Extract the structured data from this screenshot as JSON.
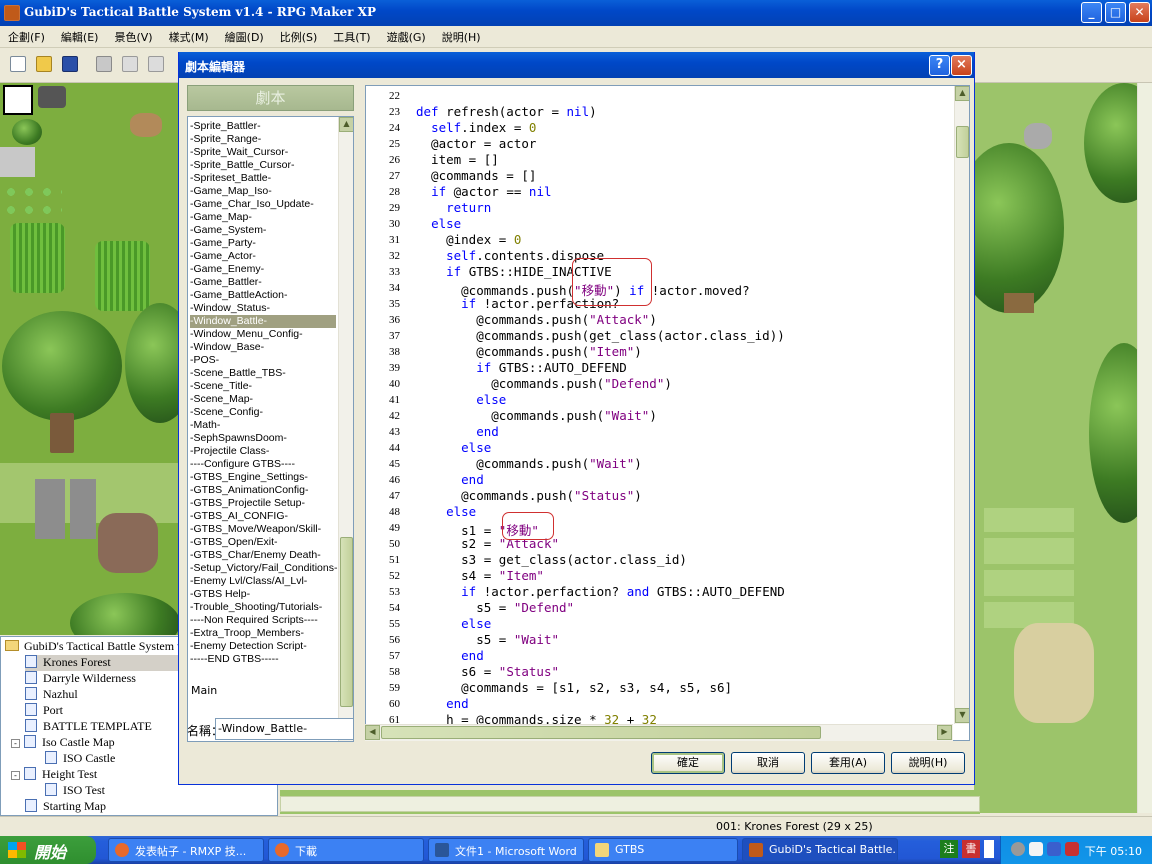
{
  "app": {
    "title": "GubiD's Tactical Battle System v1.4 - RPG Maker XP"
  },
  "menu": [
    "企劃(F)",
    "編輯(E)",
    "景色(V)",
    "樣式(M)",
    "繪圖(D)",
    "比例(S)",
    "工具(T)",
    "遊戲(G)",
    "說明(H)"
  ],
  "map_tree": {
    "root": "GubiD's Tactical Battle System v",
    "items": [
      {
        "label": "Krones Forest",
        "selected": true
      },
      {
        "label": "Darryle Wilderness"
      },
      {
        "label": "Nazhul"
      },
      {
        "label": "Port"
      },
      {
        "label": "BATTLE TEMPLATE"
      },
      {
        "label": "Iso Castle Map",
        "expander": "-"
      },
      {
        "label": "ISO Castle",
        "child": true
      },
      {
        "label": "Height Test",
        "expander": "-"
      },
      {
        "label": "ISO Test",
        "child": true
      },
      {
        "label": "Starting Map"
      }
    ]
  },
  "dialog": {
    "title": "劇本編輯器",
    "help_btn": "?",
    "close_btn": "×",
    "scripts_header": "劇本",
    "name_label": "名稱：",
    "name_value": "-Window_Battle-",
    "buttons": {
      "ok": "確定",
      "cancel": "取消",
      "apply": "套用(A)",
      "help": "說明(H)"
    }
  },
  "scripts": [
    "-Sprite_Battler-",
    "-Sprite_Range-",
    "-Sprite_Wait_Cursor-",
    "-Sprite_Battle_Cursor-",
    "-Spriteset_Battle-",
    "-Game_Map_Iso-",
    "-Game_Char_Iso_Update-",
    "-Game_Map-",
    "-Game_System-",
    "-Game_Party-",
    "-Game_Actor-",
    "-Game_Enemy-",
    "-Game_Battler-",
    "-Game_BattleAction-",
    "-Window_Status-",
    "-Window_Battle-",
    "-Window_Menu_Config-",
    "-Window_Base-",
    "-POS-",
    "-Scene_Battle_TBS-",
    "-Scene_Title-",
    "-Scene_Map-",
    "-Scene_Config-",
    "-Math-",
    "-SephSpawnsDoom-",
    "-Projectile Class-",
    "----Configure GTBS----",
    "-GTBS_Engine_Settings-",
    "-GTBS_AnimationConfig-",
    "-GTBS_Projectile Setup-",
    "-GTBS_AI_CONFIG-",
    "-GTBS_Move/Weapon/Skill-",
    "-GTBS_Open/Exit-",
    "-GTBS_Char/Enemy Death-",
    "-Setup_Victory/Fail_Conditions-",
    "-Enemy Lvl/Class/AI_Lvl-",
    "-GTBS Help-",
    "-Trouble_Shooting/Tutorials-",
    "----Non Required Scripts----",
    "-Extra_Troop_Members-",
    "-Enemy Detection Script-",
    "-----END GTBS-----"
  ],
  "scripts_selected_index": 15,
  "scripts_tail": "Main",
  "code_lines": [
    {
      "n": "22",
      "t": ""
    },
    {
      "n": "23",
      "t": "def refresh(actor = nil)"
    },
    {
      "n": "24",
      "t": "  self.index = 0"
    },
    {
      "n": "25",
      "t": "  @actor = actor"
    },
    {
      "n": "26",
      "t": "  item = []"
    },
    {
      "n": "27",
      "t": "  @commands = []"
    },
    {
      "n": "28",
      "t": "  if @actor == nil"
    },
    {
      "n": "29",
      "t": "    return"
    },
    {
      "n": "30",
      "t": "  else"
    },
    {
      "n": "31",
      "t": "    @index = 0"
    },
    {
      "n": "32",
      "t": "    self.contents.dispose"
    },
    {
      "n": "33",
      "t": "    if GTBS::HIDE_INACTIVE"
    },
    {
      "n": "34",
      "t": "      @commands.push(\"移動\") if !actor.moved?"
    },
    {
      "n": "35",
      "t": "      if !actor.perfaction?"
    },
    {
      "n": "36",
      "t": "        @commands.push(\"Attack\")"
    },
    {
      "n": "37",
      "t": "        @commands.push(get_class(actor.class_id))"
    },
    {
      "n": "38",
      "t": "        @commands.push(\"Item\")"
    },
    {
      "n": "39",
      "t": "        if GTBS::AUTO_DEFEND"
    },
    {
      "n": "40",
      "t": "          @commands.push(\"Defend\")"
    },
    {
      "n": "41",
      "t": "        else"
    },
    {
      "n": "42",
      "t": "          @commands.push(\"Wait\")"
    },
    {
      "n": "43",
      "t": "        end"
    },
    {
      "n": "44",
      "t": "      else"
    },
    {
      "n": "45",
      "t": "        @commands.push(\"Wait\")"
    },
    {
      "n": "46",
      "t": "      end"
    },
    {
      "n": "47",
      "t": "      @commands.push(\"Status\")"
    },
    {
      "n": "48",
      "t": "    else"
    },
    {
      "n": "49",
      "t": "      s1 = \"移動\""
    },
    {
      "n": "50",
      "t": "      s2 = \"Attack\""
    },
    {
      "n": "51",
      "t": "      s3 = get_class(actor.class_id)"
    },
    {
      "n": "52",
      "t": "      s4 = \"Item\""
    },
    {
      "n": "53",
      "t": "      if !actor.perfaction? and GTBS::AUTO_DEFEND"
    },
    {
      "n": "54",
      "t": "        s5 = \"Defend\""
    },
    {
      "n": "55",
      "t": "      else"
    },
    {
      "n": "56",
      "t": "        s5 = \"Wait\""
    },
    {
      "n": "57",
      "t": "      end"
    },
    {
      "n": "58",
      "t": "      s6 = \"Status\""
    },
    {
      "n": "59",
      "t": "      @commands = [s1, s2, s3, s4, s5, s6]"
    },
    {
      "n": "60",
      "t": "    end"
    },
    {
      "n": "61",
      "t": "    h = @commands.size * 32 + 32"
    }
  ],
  "status": {
    "map_info": "001: Krones Forest (29 x 25)"
  },
  "taskbar": {
    "start": "開始",
    "tasks": [
      "发表帖子 - RMXP 技...",
      "下載",
      "文件1 - Microsoft Word",
      "GTBS",
      "GubiD's Tactical Battle..."
    ],
    "clock": "下午 05:10"
  },
  "colors": {
    "accent": "#0a5fd8",
    "keyword": "#0000ff",
    "string": "#800080",
    "highlight": "#d03030"
  }
}
